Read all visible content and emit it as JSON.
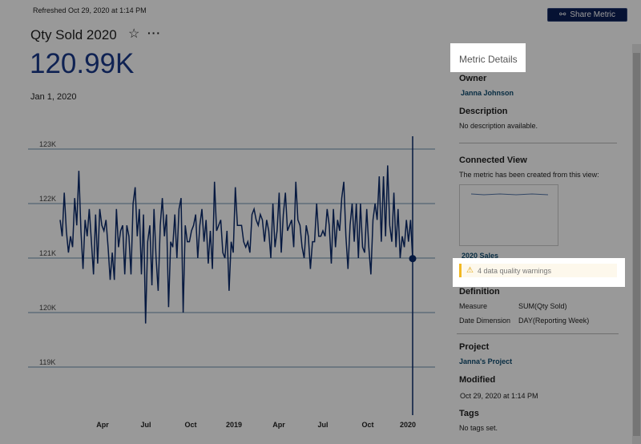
{
  "header": {
    "refreshed": "Refreshed Oct 29, 2020 at 1:14 PM",
    "title": "Qty Sold 2020",
    "value": "120.99K",
    "date": "Jan 1, 2020",
    "share_label": "Share Metric",
    "icons": [
      "star-icon",
      "more-icon",
      "share-icon"
    ]
  },
  "details": {
    "title": "Metric Details",
    "owner_label": "Owner",
    "owner": "Janna Johnson",
    "description_label": "Description",
    "description": "No description available.",
    "connected_label": "Connected View",
    "connected_text": "The metric has been created from this view:",
    "view_name": "2020 Sales",
    "warning": "4 data quality warnings",
    "definition_label": "Definition",
    "measure_label": "Measure",
    "measure": "SUM(Qty Sold)",
    "date_dim_label": "Date Dimension",
    "date_dim": "DAY(Reporting Week)",
    "project_label": "Project",
    "project": "Janna's Project",
    "modified_label": "Modified",
    "modified": "Oct 29, 2020 at 1:14 PM",
    "tags_label": "Tags",
    "tags": "No tags set."
  },
  "colors": {
    "line": "#0b2a6b",
    "value": "#1a3a8a",
    "warning": "#f2b823",
    "button": "#0b1f55"
  },
  "chart_data": {
    "type": "line",
    "y_ticks": [
      "123K",
      "122K",
      "121K",
      "120K",
      "119K"
    ],
    "ylim": [
      118.6,
      123.3
    ],
    "x_ticks": [
      "Apr",
      "Jul",
      "Oct",
      "2019",
      "Apr",
      "Jul",
      "Oct",
      "2020"
    ],
    "grid": true,
    "highlight": {
      "x": "Jan 1, 2020",
      "y": 120.99
    },
    "values": [
      121.7,
      121.4,
      122.2,
      121.5,
      121.1,
      121.4,
      121.2,
      122.1,
      121.6,
      122.6,
      121.5,
      120.8,
      121.7,
      121.4,
      121.9,
      121.3,
      120.7,
      121.8,
      120.9,
      121.9,
      121.6,
      121.5,
      121.7,
      121.2,
      120.6,
      121.1,
      120.6,
      121.9,
      121.2,
      121.5,
      121.6,
      120.7,
      121.6,
      121.4,
      120.7,
      122.0,
      122.3,
      121.4,
      121.9,
      120.7,
      121.8,
      119.8,
      121.3,
      121.6,
      120.5,
      121.9,
      121.0,
      120.4,
      121.6,
      122.1,
      121.4,
      121.8,
      120.1,
      121.3,
      121.2,
      121.8,
      121.0,
      121.9,
      122.1,
      120.0,
      121.6,
      121.3,
      121.3,
      121.5,
      121.6,
      121.8,
      121.0,
      121.6,
      121.9,
      121.3,
      121.7,
      120.9,
      121.5,
      120.8,
      122.4,
      121.5,
      121.6,
      121.7,
      121.1,
      121.0,
      121.5,
      120.4,
      121.3,
      121.1,
      122.3,
      121.6,
      121.6,
      121.6,
      121.3,
      121.2,
      121.3,
      121.1,
      121.8,
      121.9,
      121.7,
      121.6,
      121.8,
      121.7,
      121.3,
      121.7,
      121.5,
      121.0,
      122.0,
      121.2,
      121.5,
      122.2,
      121.1,
      121.8,
      122.2,
      121.5,
      121.6,
      121.7,
      121.2,
      122.4,
      121.7,
      121.6,
      121.2,
      121.0,
      121.6,
      121.4,
      120.8,
      121.3,
      121.3,
      122.0,
      121.4,
      121.4,
      121.5,
      121.4,
      121.9,
      121.6,
      120.9,
      121.9,
      121.2,
      121.7,
      121.5,
      122.1,
      122.4,
      121.4,
      120.8,
      121.6,
      122.0,
      121.3,
      122.0,
      121.0,
      122.0,
      121.2,
      121.1,
      121.9,
      121.2,
      120.7,
      121.7,
      122.0,
      121.7,
      122.5,
      121.3,
      122.5,
      121.4,
      122.7,
      121.6,
      121.3,
      122.2,
      121.2,
      121.9,
      121.0,
      121.4,
      121.2,
      121.7,
      121.3,
      121.7,
      120.99
    ]
  }
}
